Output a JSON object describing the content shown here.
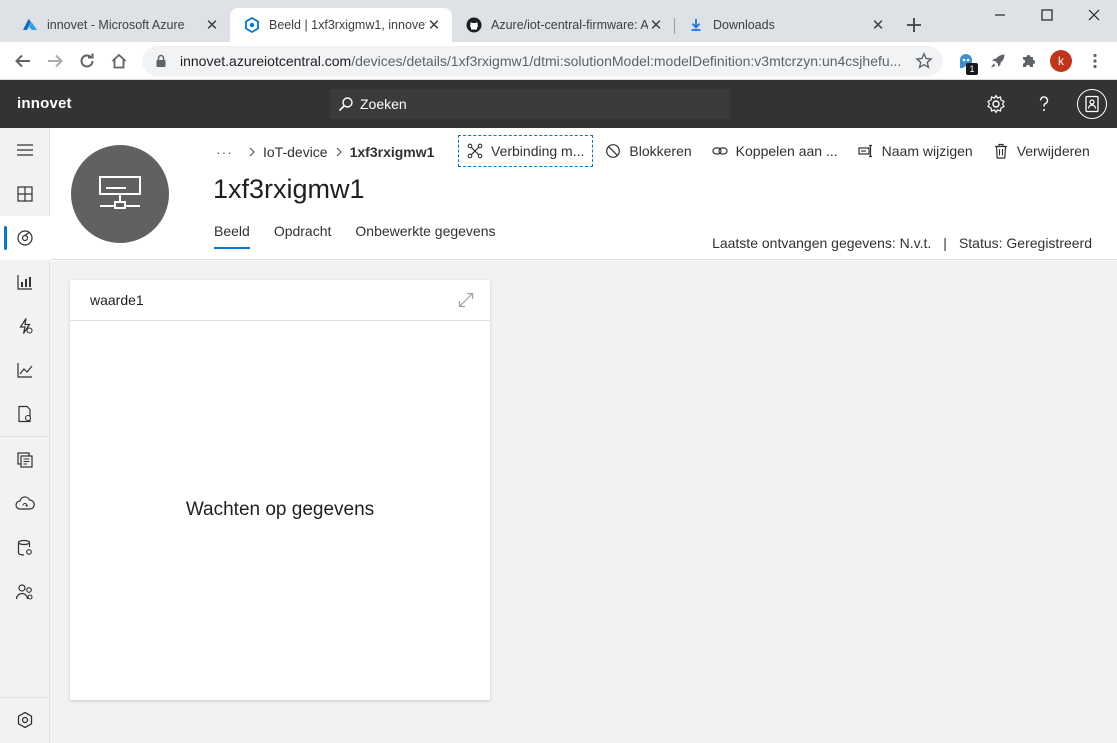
{
  "browser": {
    "tabs": [
      {
        "title": "innovet - Microsoft Azure",
        "icon": "azure-icon"
      },
      {
        "title": "Beeld | 1xf3rxigmw1, innovet",
        "icon": "iot-central-icon"
      },
      {
        "title": "Azure/iot-central-firmware: A",
        "icon": "github-icon"
      },
      {
        "title": "Downloads",
        "icon": "download-icon"
      }
    ],
    "url_host": "innovet.azureiotcentral.com",
    "url_path": "/devices/details/1xf3rxigmw1/dtmi:solutionModel:modelDefinition:v3mtcrzyn:un4csjhefu...",
    "extension_badge": "1",
    "profile_initial": "k"
  },
  "app": {
    "name": "innovet",
    "search_placeholder": "Zoeken"
  },
  "device": {
    "breadcrumb_more": "···",
    "breadcrumb_parent": "IoT-device",
    "breadcrumb_current": "1xf3rxigmw1",
    "title": "1xf3rxigmw1",
    "tabs": [
      "Beeld",
      "Opdracht",
      "Onbewerkte gegevens"
    ],
    "active_tab": "Beeld",
    "commands": {
      "connect": "Verbinding m...",
      "block": "Blokkeren",
      "attach": "Koppelen aan ...",
      "rename": "Naam wijzigen",
      "delete": "Verwijderen"
    },
    "last_data": "Laatste ontvangen gegevens: N.v.t.",
    "status_sep": "|",
    "status": "Status: Geregistreerd"
  },
  "tile": {
    "title": "waarde1",
    "message": "Wachten op gegevens"
  },
  "colors": {
    "accent": "#0078d4",
    "header_bg": "#333333",
    "profile": "#c1351a"
  }
}
